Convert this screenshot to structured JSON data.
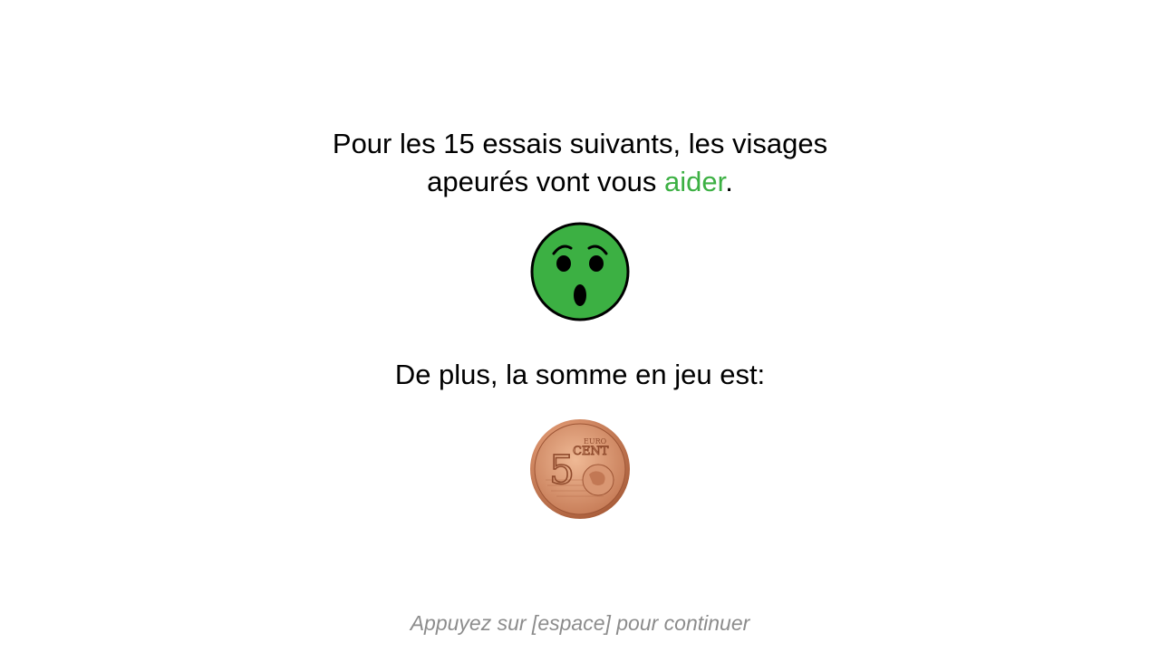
{
  "instruction": {
    "line1": "Pour les 15 essais suivants, les visages",
    "line2_before": "apeurés vont vous ",
    "line2_highlight": "aider",
    "line2_after": "."
  },
  "face": {
    "icon": "fearful-face-icon",
    "color": "#3cb043"
  },
  "amount_label": "De plus, la somme en jeu est:",
  "coin": {
    "icon": "five-euro-cent-coin-icon",
    "numeral": "5",
    "text_top": "EURO",
    "text_bottom": "CENT"
  },
  "prompt": "Appuyez sur [espace] pour continuer",
  "colors": {
    "highlight": "#3cb043",
    "prompt": "#8c8c8c",
    "coin": "#c8794f"
  }
}
